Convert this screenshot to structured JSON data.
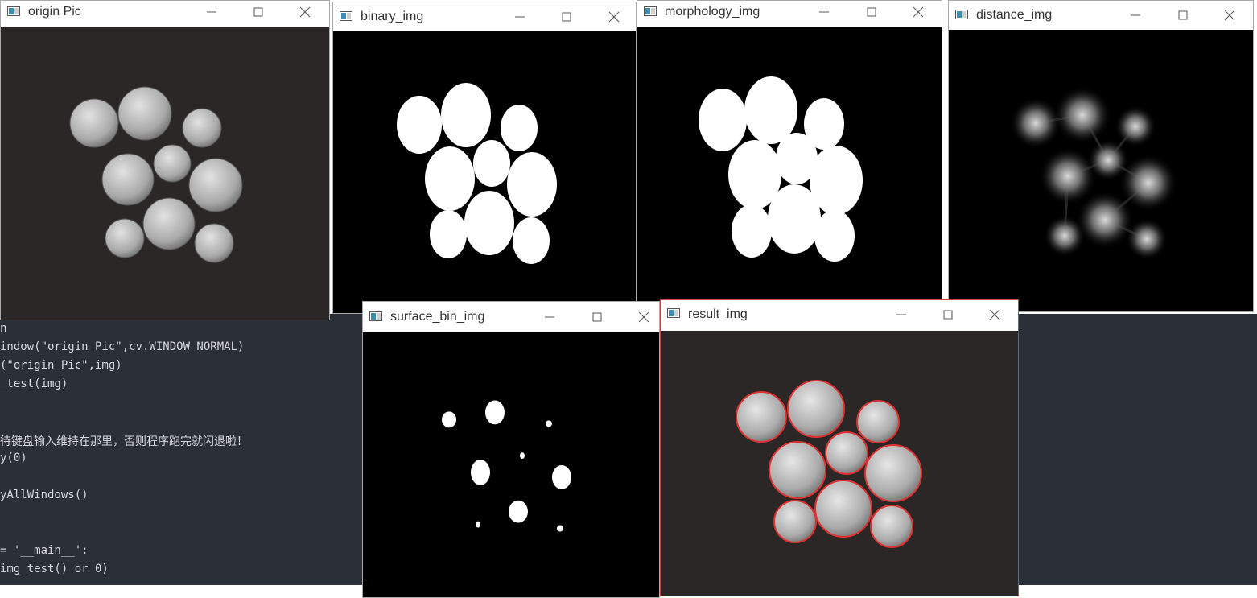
{
  "editor": {
    "lines": [
      "n",
      "indow(\"origin Pic\",cv.WINDOW_NORMAL)",
      "(\"origin Pic\",img)",
      "_test(img)",
      "",
      "",
      "待键盘输入维持在那里，否则程序跑完就闪退啦！",
      "y(0)",
      "",
      "yAllWindows()",
      "",
      "",
      "= '__main__':",
      "img_test() or 0)"
    ]
  },
  "windows": [
    {
      "id": "origin",
      "title": "origin Pic",
      "icon": "image-window-icon"
    },
    {
      "id": "binary",
      "title": "binary_img",
      "icon": "image-window-icon"
    },
    {
      "id": "morphology",
      "title": "morphology_img",
      "icon": "image-window-icon"
    },
    {
      "id": "distance",
      "title": "distance_img",
      "icon": "image-window-icon"
    },
    {
      "id": "surface",
      "title": "surface_bin_img",
      "icon": "image-window-icon"
    },
    {
      "id": "result",
      "title": "result_img",
      "icon": "image-window-icon"
    }
  ],
  "colors": {
    "editor_bg": "#2b2f38",
    "editor_text": "#d5d8dd",
    "active_border": "#d04040",
    "contour": "#e03030"
  }
}
